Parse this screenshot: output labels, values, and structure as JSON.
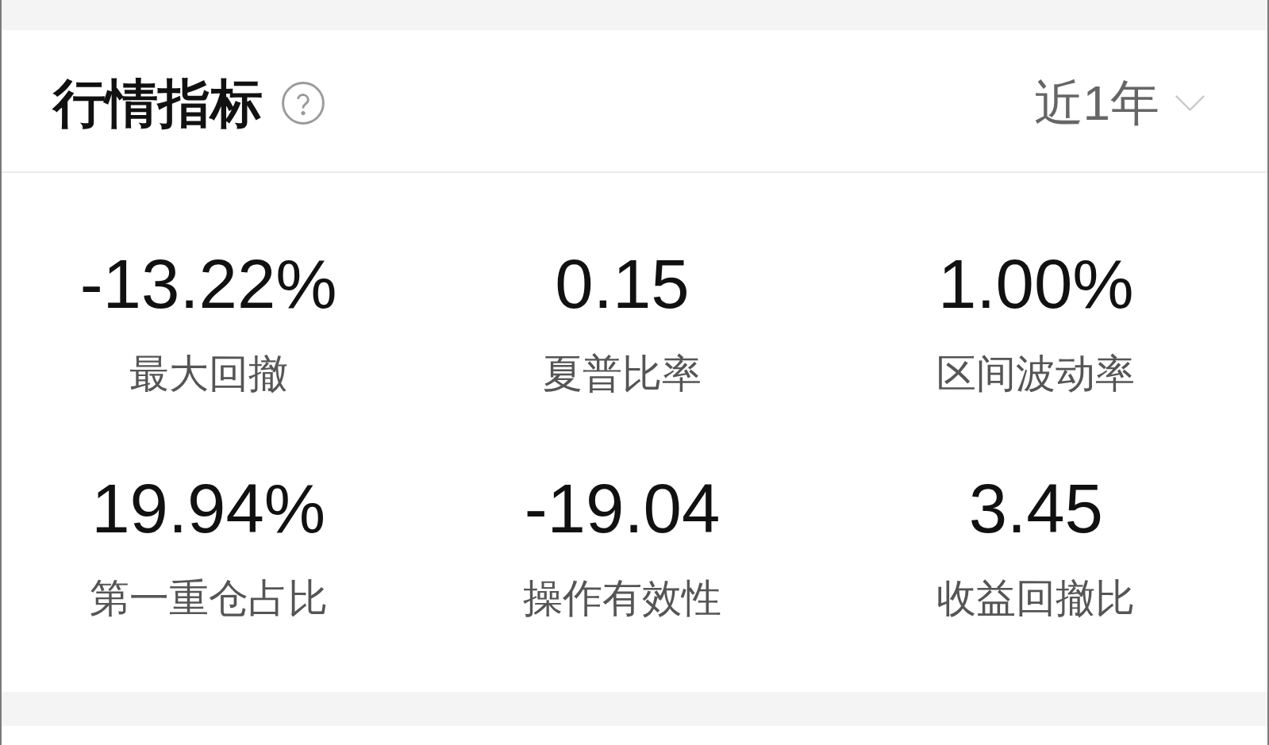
{
  "header": {
    "title": "行情指标",
    "period": "近1年"
  },
  "metrics": [
    {
      "value": "-13.22%",
      "label": "最大回撤"
    },
    {
      "value": "0.15",
      "label": "夏普比率"
    },
    {
      "value": "1.00%",
      "label": "区间波动率"
    },
    {
      "value": "19.94%",
      "label": "第一重仓占比"
    },
    {
      "value": "-19.04",
      "label": "操作有效性"
    },
    {
      "value": "3.45",
      "label": "收益回撤比"
    }
  ]
}
